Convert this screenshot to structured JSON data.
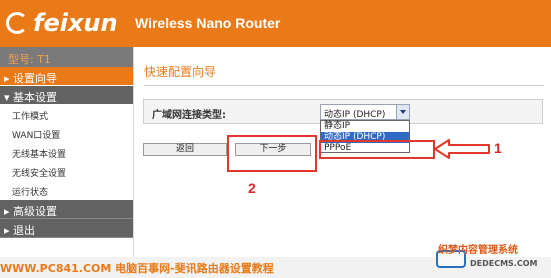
{
  "header": {
    "brand": "feixun",
    "product_title": "Wireless Nano Router"
  },
  "sidebar": {
    "model": "型号: T1",
    "items": [
      {
        "label": "▸ 设置向导",
        "type": "group",
        "state": "active"
      },
      {
        "label": "▾ 基本设置",
        "type": "group",
        "state": "expanded"
      },
      {
        "label": "工作模式",
        "type": "sub"
      },
      {
        "label": "WAN口设置",
        "type": "sub"
      },
      {
        "label": "无线基本设置",
        "type": "sub"
      },
      {
        "label": "无线安全设置",
        "type": "sub"
      },
      {
        "label": "运行状态",
        "type": "sub"
      },
      {
        "label": "▸ 高级设置",
        "type": "group"
      },
      {
        "label": "▸ 退出",
        "type": "group"
      }
    ]
  },
  "main": {
    "page_title": "快速配置向导",
    "connection_label": "广域网连接类型:",
    "select_value": "动态IP (DHCP)",
    "dropdown_options": [
      "静态IP",
      "动态IP (DHCP)",
      "PPPoE"
    ],
    "selected_option_index": 1,
    "back_button": "返回",
    "next_button": "下一步"
  },
  "annotations": {
    "num_1": "1",
    "num_2": "2",
    "color": "#e0382c"
  },
  "footer": {
    "text": "WWW.PC841.COM 电脑百事网-斐讯路由器设置教程"
  },
  "watermark": {
    "title": "织梦内容管理系统",
    "domain": "DEDECMS.COM"
  },
  "colors": {
    "accent": "#e97a17",
    "nav_dark": "#626262",
    "selection": "#316ac5"
  }
}
